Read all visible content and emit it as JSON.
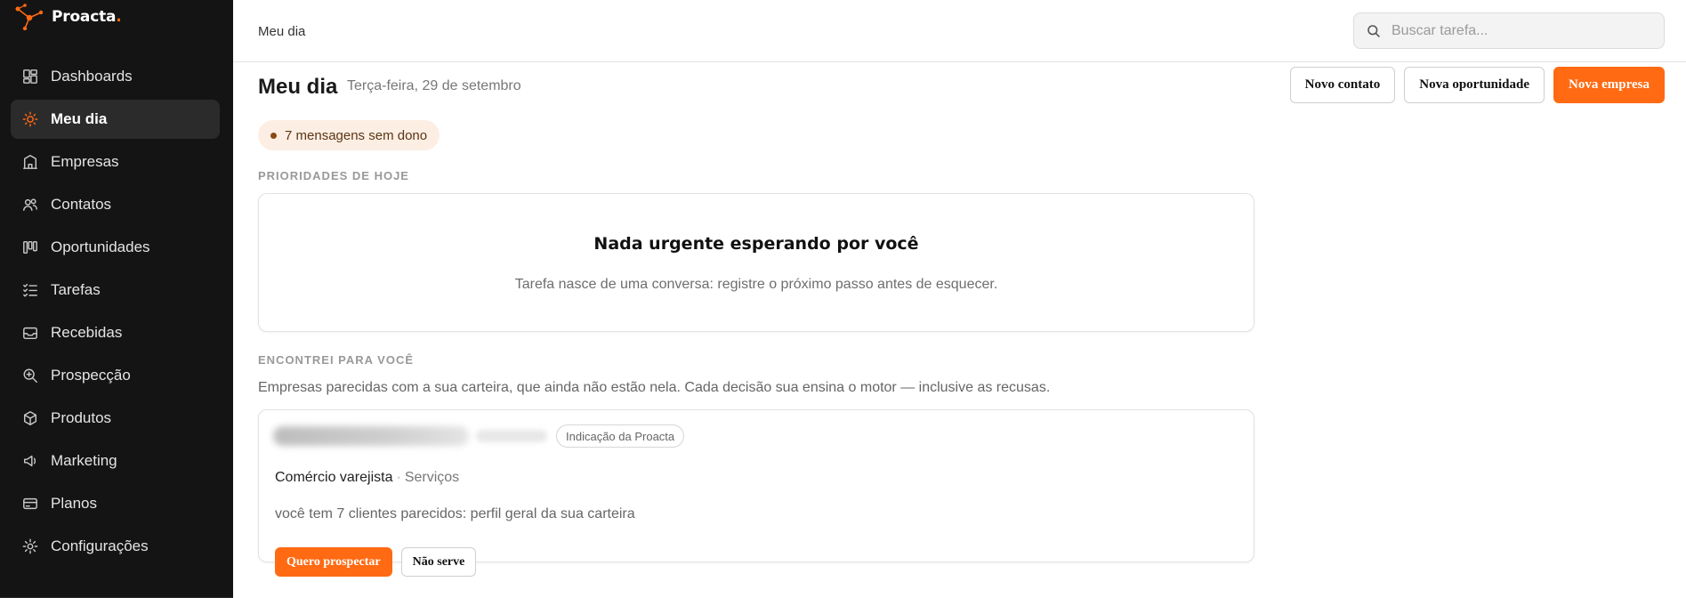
{
  "brand": {
    "name": "Proacta",
    "dot": "."
  },
  "sidebar": {
    "items": [
      {
        "label": "Dashboards",
        "icon": "dashboard-icon"
      },
      {
        "label": "Meu dia",
        "icon": "sun-icon",
        "active": true
      },
      {
        "label": "Empresas",
        "icon": "building-icon"
      },
      {
        "label": "Contatos",
        "icon": "users-icon"
      },
      {
        "label": "Oportunidades",
        "icon": "kanban-icon"
      },
      {
        "label": "Tarefas",
        "icon": "checklist-icon"
      },
      {
        "label": "Recebidas",
        "icon": "inbox-icon"
      },
      {
        "label": "Prospecção",
        "icon": "search-plus-icon"
      },
      {
        "label": "Produtos",
        "icon": "box-icon"
      },
      {
        "label": "Marketing",
        "icon": "megaphone-icon"
      },
      {
        "label": "Planos",
        "icon": "card-icon"
      },
      {
        "label": "Configurações",
        "icon": "gear-icon"
      }
    ]
  },
  "topbar": {
    "breadcrumb": "Meu dia",
    "search_placeholder": "Buscar tarefa..."
  },
  "page": {
    "title": "Meu dia",
    "date": "Terça-feira, 29 de setembro",
    "actions": {
      "new_contact": "Novo contato",
      "new_opportunity": "Nova oportunidade",
      "new_company": "Nova empresa"
    },
    "pill": "7 mensagens sem dono"
  },
  "priorities": {
    "label": "PRIORIDADES DE HOJE",
    "empty_title": "Nada urgente esperando por você",
    "empty_subtitle": "Tarefa nasce de uma conversa: registre o próximo passo antes de esquecer."
  },
  "suggestions": {
    "label": "ENCONTREI PARA VOCÊ",
    "description": "Empresas parecidas com a sua carteira, que ainda não estão nela. Cada decisão sua ensina o motor — inclusive as recusas.",
    "card": {
      "tag": "Indicação da Proacta",
      "segment": "Comércio varejista",
      "separator": "·",
      "subsegment": "Serviços",
      "reason": "você tem 7 clientes parecidos: perfil geral da sua carteira",
      "accept": "Quero prospectar",
      "reject": "Não serve"
    }
  },
  "colors": {
    "accent": "#ff6a13",
    "sidebar_bg": "#141414"
  }
}
